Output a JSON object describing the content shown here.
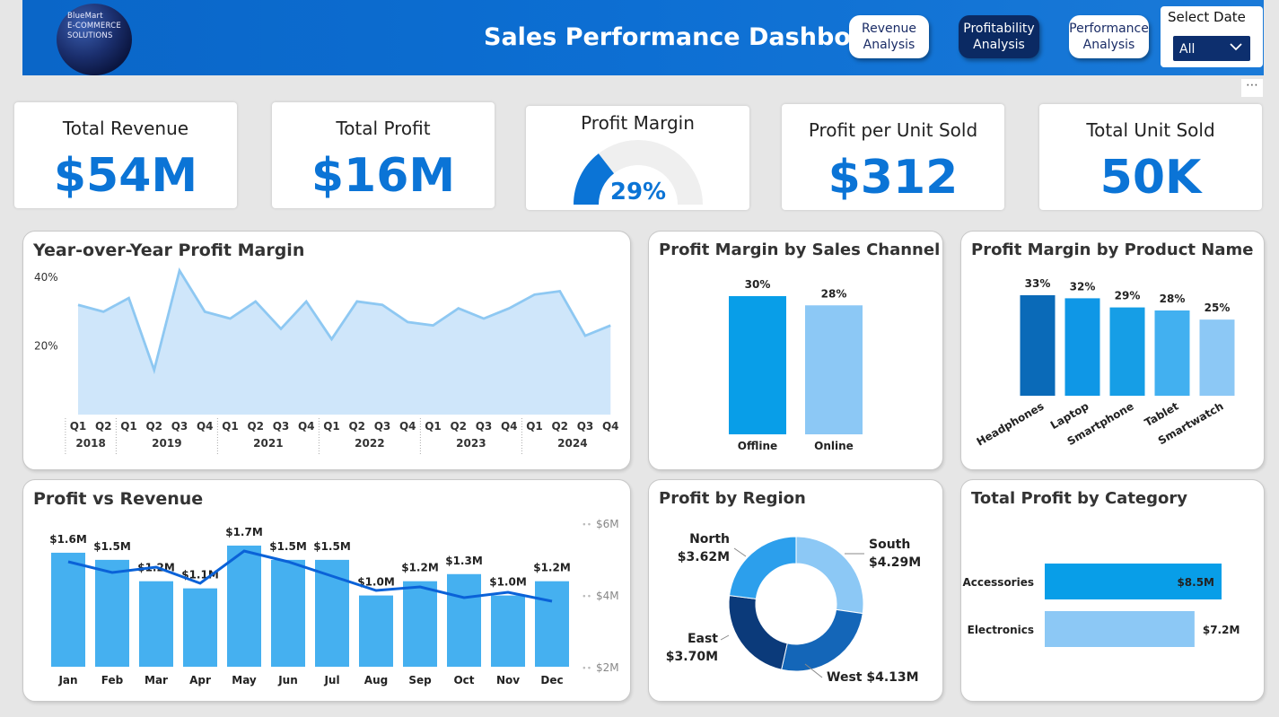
{
  "header": {
    "logo_lines": [
      "BlueMart",
      "E-COMMERCE",
      "SOLUTIONS"
    ],
    "title": "Sales Performance Dashboard",
    "nav": [
      {
        "line1": "Revenue",
        "line2": "Analysis",
        "active": false
      },
      {
        "line1": "Profitability",
        "line2": "Analysis",
        "active": true
      },
      {
        "line1": "Performance",
        "line2": "Analysis",
        "active": false
      }
    ],
    "date_label": "Select Date",
    "date_value": "All",
    "more_label": "⋯"
  },
  "kpis": {
    "total_revenue": {
      "title": "Total Revenue",
      "value": "$54M"
    },
    "total_profit": {
      "title": "Total Profit",
      "value": "$16M"
    },
    "profit_margin": {
      "title": "Profit Margin",
      "value": "29%",
      "fraction": 0.29
    },
    "profit_per_unit": {
      "title": "Profit per Unit Sold",
      "value": "$312"
    },
    "total_units": {
      "title": "Total Unit Sold",
      "value": "50K"
    }
  },
  "colors": {
    "accent": "#0b74d6",
    "area_line": "#8ec8f2",
    "area_fill": "#cfe6fa",
    "bar_main": "#45b0f0",
    "revenue_line": "#0a62d8",
    "dark_blue": "#0b3a7a",
    "mid_blue": "#1466b8"
  },
  "chart_data": [
    {
      "id": "yoy",
      "type": "area",
      "title": "Year-over-Year Profit Margin",
      "y_ticks": [
        "20%",
        "40%"
      ],
      "ylim": [
        0,
        0.55
      ],
      "quarter_labels": [
        "Q1",
        "Q2",
        "Q1",
        "Q2",
        "Q3",
        "Q4",
        "Q1",
        "Q2",
        "Q3",
        "Q4",
        "Q1",
        "Q2",
        "Q3",
        "Q4",
        "Q1",
        "Q2",
        "Q3",
        "Q4",
        "Q1",
        "Q2",
        "Q3",
        "Q4"
      ],
      "year_groups": [
        {
          "label": "2018",
          "count": 2
        },
        {
          "label": "2019",
          "count": 4
        },
        {
          "label": "2021",
          "count": 4
        },
        {
          "label": "2022",
          "count": 4
        },
        {
          "label": "2023",
          "count": 4
        },
        {
          "label": "2024",
          "count": 4
        }
      ],
      "values": [
        0.32,
        0.3,
        0.34,
        0.13,
        0.42,
        0.3,
        0.28,
        0.33,
        0.25,
        0.33,
        0.22,
        0.33,
        0.32,
        0.27,
        0.26,
        0.31,
        0.28,
        0.31,
        0.35,
        0.36,
        0.23,
        0.26
      ]
    },
    {
      "id": "channel",
      "type": "bar",
      "title": "Profit Margin by Sales Channel",
      "categories": [
        "Offline",
        "Online"
      ],
      "values": [
        0.3,
        0.28
      ],
      "labels": [
        "30%",
        "28%"
      ],
      "colors": [
        "#089ee8",
        "#8cc8f5"
      ]
    },
    {
      "id": "product",
      "type": "bar",
      "title": "Profit Margin by Product Name",
      "categories": [
        "Headphones",
        "Laptop",
        "Smartphone",
        "Tablet",
        "Smartwatch"
      ],
      "values": [
        0.33,
        0.32,
        0.29,
        0.28,
        0.25
      ],
      "labels": [
        "33%",
        "32%",
        "29%",
        "28%",
        "25%"
      ],
      "colors": [
        "#0a6ab8",
        "#0f97e6",
        "#169ee6",
        "#42b0f0",
        "#8cc8f5"
      ]
    },
    {
      "id": "pvr",
      "type": "bar",
      "title": "Profit vs Revenue",
      "categories": [
        "Jan",
        "Feb",
        "Mar",
        "Apr",
        "May",
        "Jun",
        "Jul",
        "Aug",
        "Sep",
        "Oct",
        "Nov",
        "Dec"
      ],
      "series": [
        {
          "name": "Profit",
          "values": [
            1.6,
            1.5,
            1.2,
            1.1,
            1.7,
            1.5,
            1.5,
            1.0,
            1.2,
            1.3,
            1.0,
            1.2
          ],
          "labels": [
            "$1.6M",
            "$1.5M",
            "$1.2M",
            "$1.1M",
            "$1.7M",
            "$1.5M",
            "$1.5M",
            "$1.0M",
            "$1.2M",
            "$1.3M",
            "$1.0M",
            "$1.2M"
          ]
        },
        {
          "name": "Revenue",
          "values": [
            4.95,
            4.65,
            4.8,
            4.35,
            5.25,
            4.95,
            4.55,
            4.15,
            4.25,
            3.95,
            4.1,
            3.85
          ]
        }
      ],
      "bar_ylim": [
        0,
        1.9
      ],
      "line_ylim": [
        2,
        6
      ],
      "right_ticks": [
        "$6M",
        "$4M",
        "$2M"
      ]
    },
    {
      "id": "region",
      "type": "pie",
      "title": "Profit by Region",
      "slices": [
        {
          "name": "South",
          "value": 4.29,
          "label": "$4.29M",
          "color": "#8cc8f5"
        },
        {
          "name": "West",
          "value": 4.13,
          "label": "$4.13M",
          "color": "#1466b8"
        },
        {
          "name": "East",
          "value": 3.7,
          "label": "$3.70M",
          "color": "#0b3a7a"
        },
        {
          "name": "North",
          "value": 3.62,
          "label": "$3.62M",
          "color": "#2c9fec"
        }
      ]
    },
    {
      "id": "category",
      "type": "bar",
      "title": "Total Profit by Category",
      "orientation": "horizontal",
      "categories": [
        "Accessories",
        "Electronics"
      ],
      "values": [
        8.5,
        7.2
      ],
      "labels": [
        "$8.5M",
        "$7.2M"
      ],
      "colors": [
        "#089ee8",
        "#8cc8f5"
      ],
      "xlim": [
        0,
        8.8
      ]
    }
  ]
}
